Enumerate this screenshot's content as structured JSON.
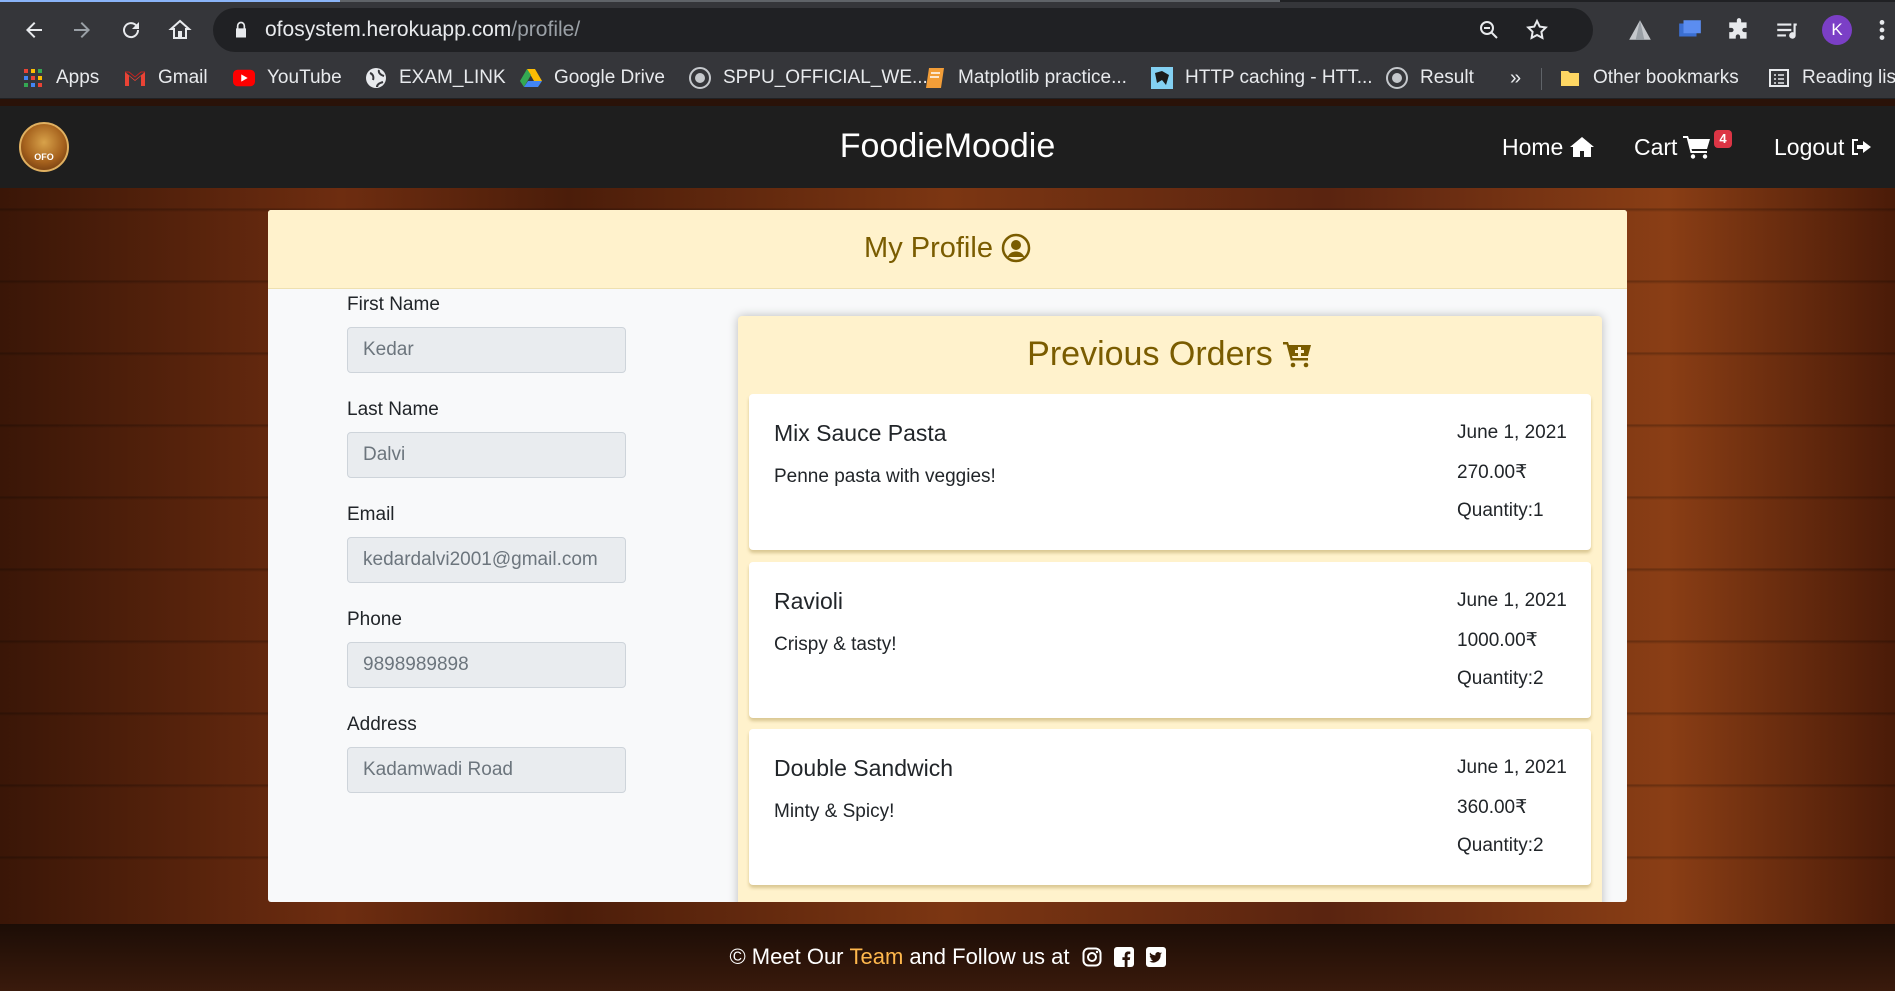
{
  "browser": {
    "url_host": "ofosystem.herokuapp.com",
    "url_path": "/profile/",
    "profile_initial": "K",
    "bookmarks": [
      {
        "label": "Apps",
        "icon": "apps-grid-icon"
      },
      {
        "label": "Gmail",
        "icon": "gmail-icon"
      },
      {
        "label": "YouTube",
        "icon": "youtube-icon"
      },
      {
        "label": "EXAM_LINK",
        "icon": "globe-icon"
      },
      {
        "label": "Google Drive",
        "icon": "google-drive-icon"
      },
      {
        "label": "SPPU_OFFICIAL_WE...",
        "icon": "sppu-icon"
      },
      {
        "label": "Matplotlib practice...",
        "icon": "notebook-icon"
      },
      {
        "label": "HTTP caching - HTT...",
        "icon": "mdn-icon"
      },
      {
        "label": "Result",
        "icon": "sppu-icon"
      }
    ],
    "overflow_label": "»",
    "other_bookmarks": "Other bookmarks",
    "reading_list": "Reading list"
  },
  "site": {
    "brand": "FoodieMoodie",
    "logo_text": "OFO",
    "nav": {
      "home": "Home",
      "cart": "Cart",
      "cart_count": "4",
      "logout": "Logout"
    }
  },
  "profile": {
    "title": "My Profile",
    "fields": [
      {
        "label": "First Name",
        "value": "Kedar"
      },
      {
        "label": "Last Name",
        "value": "Dalvi"
      },
      {
        "label": "Email",
        "value": "kedardalvi2001@gmail.com"
      },
      {
        "label": "Phone",
        "value": "9898989898"
      },
      {
        "label": "Address",
        "value": "Kadamwadi Road"
      }
    ]
  },
  "orders": {
    "title": "Previous Orders",
    "items": [
      {
        "name": "Mix Sauce Pasta",
        "desc": "Penne pasta with veggies!",
        "date": "June 1, 2021",
        "price": "270.00₹",
        "qty": "Quantity:1"
      },
      {
        "name": "Ravioli",
        "desc": "Crispy & tasty!",
        "date": "June 1, 2021",
        "price": "1000.00₹",
        "qty": "Quantity:2"
      },
      {
        "name": "Double Sandwich",
        "desc": "Minty & Spicy!",
        "date": "June 1, 2021",
        "price": "360.00₹",
        "qty": "Quantity:2"
      }
    ]
  },
  "footer": {
    "prefix": "© Meet Our",
    "team": "Team",
    "suffix": "and Follow us at"
  },
  "colors": {
    "header_bg": "#fff2cc",
    "title_text": "#7a5c00",
    "cart_badge": "#dc3545",
    "team_link": "#ffb84d"
  }
}
